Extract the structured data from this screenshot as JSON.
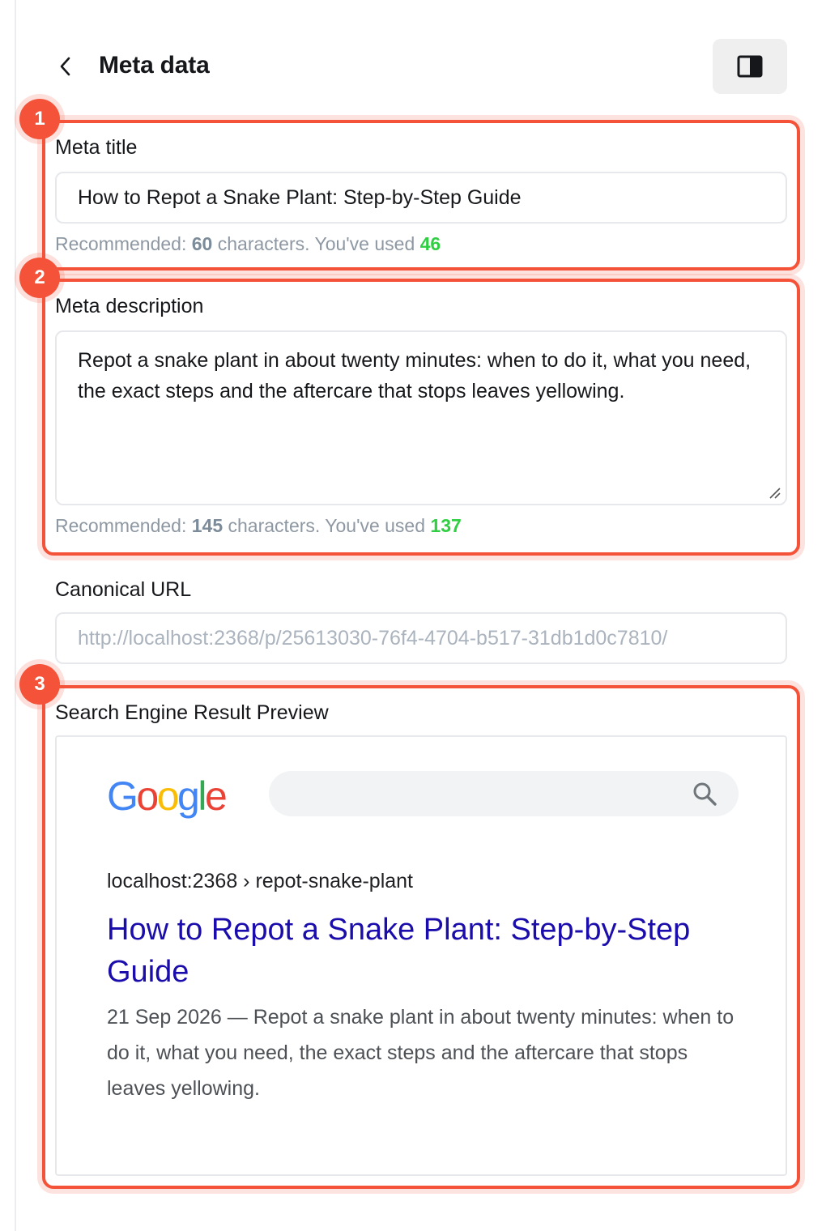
{
  "header": {
    "back_icon": "chevron-left-icon",
    "title": "Meta data",
    "panel_icon": "sidebar-toggle-icon"
  },
  "annotations": [
    "1",
    "2",
    "3"
  ],
  "meta_title": {
    "label": "Meta title",
    "value": "How to Repot a Snake Plant: Step-by-Step Guide",
    "hint_prefix": "Recommended: ",
    "recommended": "60",
    "hint_middle": " characters. You've used ",
    "used": "46"
  },
  "meta_description": {
    "label": "Meta description",
    "value": "Repot a snake plant in about twenty minutes: when to do it, what you need, the exact steps and the aftercare that stops leaves yellowing.",
    "hint_prefix": "Recommended: ",
    "recommended": "145",
    "hint_middle": " characters. You've used ",
    "used": "137"
  },
  "canonical": {
    "label": "Canonical URL",
    "placeholder": "http://localhost:2368/p/25613030-76f4-4704-b517-31db1d0c7810/"
  },
  "serp_preview": {
    "label": "Search Engine Result Preview",
    "logo_letters": [
      "G",
      "o",
      "o",
      "g",
      "l",
      "e"
    ],
    "search_icon": "search-icon",
    "url": "localhost:2368 › repot-snake-plant",
    "title": "How to Repot a Snake Plant: Step-by-Step Guide",
    "description": "21 Sep 2026 — Repot a snake plant in about twenty minutes: when to do it, what you need, the exact steps and the aftercare that stops leaves yellowing."
  },
  "colors": {
    "annotation": "#f4533a",
    "ok_count": "#30cf43",
    "serp_link": "#1a0dab",
    "google_blue": "#4285f4",
    "google_red": "#ea4335",
    "google_yellow": "#fbbc05",
    "google_green": "#34a853"
  }
}
